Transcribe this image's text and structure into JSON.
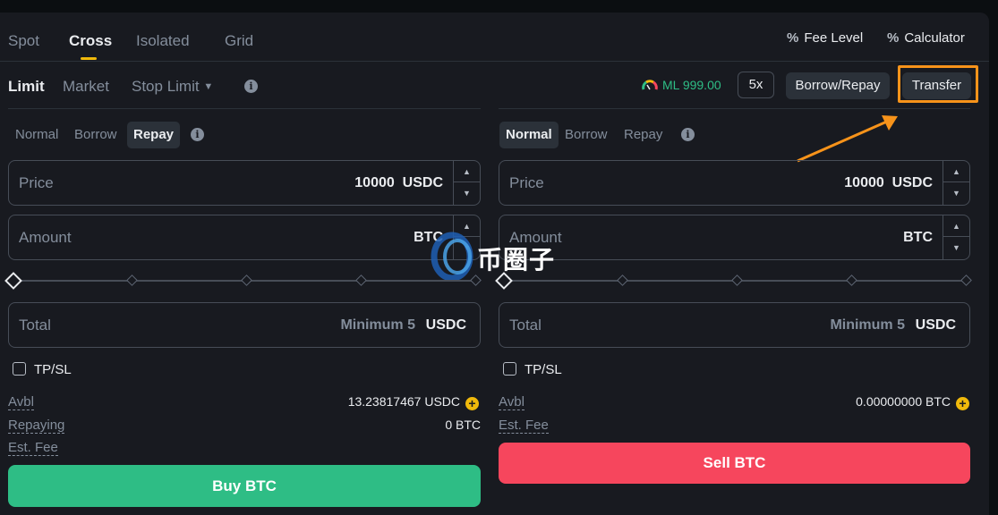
{
  "tabs": [
    {
      "label": "Spot"
    },
    {
      "label": "Cross"
    },
    {
      "label": "Isolated"
    },
    {
      "label": "Grid"
    }
  ],
  "header_right": {
    "fee_level": "Fee Level",
    "calculator": "Calculator"
  },
  "order_types": {
    "limit": "Limit",
    "market": "Market",
    "stop_limit": "Stop Limit"
  },
  "info_glyph": "i",
  "margin_level": "ML 999.00",
  "leverage": "5x",
  "borrow_repay": "Borrow/Repay",
  "transfer": "Transfer",
  "buy_panel": {
    "modes": [
      "Normal",
      "Borrow",
      "Repay"
    ],
    "active_mode": "Repay",
    "price_label": "Price",
    "price_value": "10000",
    "price_unit": "USDC",
    "amount_label": "Amount",
    "amount_unit": "BTC",
    "total_label": "Total",
    "total_placeholder": "Minimum 5",
    "total_unit": "USDC",
    "tpsl": "TP/SL",
    "avbl_label": "Avbl",
    "avbl_value": "13.23817467 USDC",
    "repaying_label": "Repaying",
    "repaying_value": "0 BTC",
    "fee_label": "Est. Fee",
    "button": "Buy BTC"
  },
  "sell_panel": {
    "modes": [
      "Normal",
      "Borrow",
      "Repay"
    ],
    "active_mode": "Normal",
    "price_label": "Price",
    "price_value": "10000",
    "price_unit": "USDC",
    "amount_label": "Amount",
    "amount_unit": "BTC",
    "total_label": "Total",
    "total_placeholder": "Minimum 5",
    "total_unit": "USDC",
    "tpsl": "TP/SL",
    "avbl_label": "Avbl",
    "avbl_value": "0.00000000 BTC",
    "fee_label": "Est. Fee",
    "button": "Sell BTC"
  },
  "watermark": "币圈子",
  "colors": {
    "accent": "#f0b90b",
    "buy": "#2ebd85",
    "sell": "#f6465d",
    "highlight": "#f7931a"
  }
}
